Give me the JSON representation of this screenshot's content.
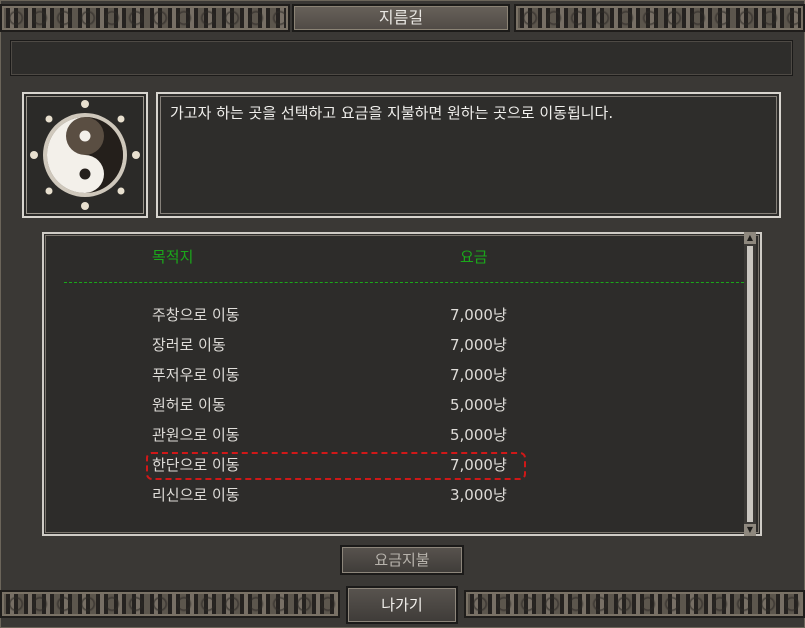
{
  "window": {
    "title": "지름길"
  },
  "description": "가고자 하는 곳을 선택하고 요금을 지불하면 원하는 곳으로 이동됩니다.",
  "icon": "yin-yang-icon",
  "list": {
    "headers": {
      "destination": "목적지",
      "fee": "요금"
    },
    "rows": [
      {
        "destination": "주창으로 이동",
        "fee": "7,000냥"
      },
      {
        "destination": "장러로 이동",
        "fee": "7,000냥"
      },
      {
        "destination": "푸저우로 이동",
        "fee": "7,000냥"
      },
      {
        "destination": "원허로 이동",
        "fee": "5,000냥"
      },
      {
        "destination": "관원으로 이동",
        "fee": "5,000냥"
      },
      {
        "destination": "한단으로 이동",
        "fee": "7,000냥"
      },
      {
        "destination": "리신으로 이동",
        "fee": "3,000냥"
      }
    ],
    "header_color": "#1aa81a",
    "highlight_color": "#d01818"
  },
  "buttons": {
    "pay": "요금지불",
    "exit": "나가기"
  }
}
